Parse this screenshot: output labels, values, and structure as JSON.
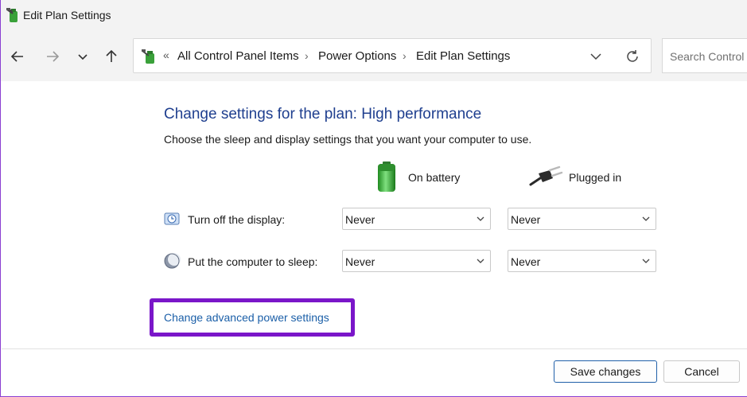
{
  "window": {
    "title": "Edit Plan Settings"
  },
  "address": {
    "overflow_chevron": "«",
    "crumbs": [
      "All Control Panel Items",
      "Power Options",
      "Edit Plan Settings"
    ],
    "separator": "›"
  },
  "search": {
    "placeholder": "Search Control"
  },
  "main": {
    "heading": "Change settings for the plan: High performance",
    "subtext": "Choose the sleep and display settings that you want your computer to use.",
    "columns": {
      "battery": "On battery",
      "plugged": "Plugged in"
    },
    "rows": [
      {
        "label": "Turn off the display:",
        "battery_value": "Never",
        "plugged_value": "Never"
      },
      {
        "label": "Put the computer to sleep:",
        "battery_value": "Never",
        "plugged_value": "Never"
      }
    ],
    "advanced_link": "Change advanced power settings"
  },
  "footer": {
    "save_label": "Save changes",
    "cancel_label": "Cancel"
  },
  "colors": {
    "heading": "#1f3f8f",
    "link": "#1b5fa8",
    "highlight": "#7a16c9"
  }
}
